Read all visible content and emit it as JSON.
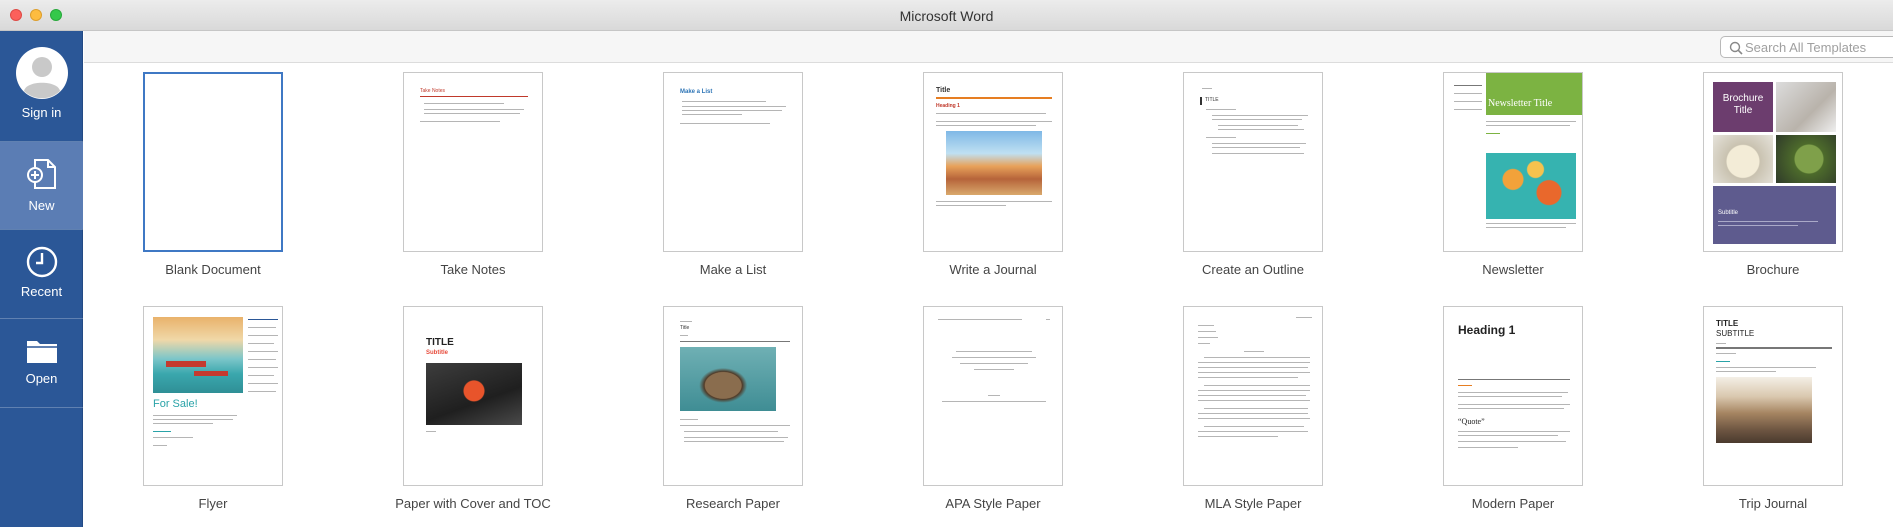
{
  "window": {
    "title": "Microsoft Word"
  },
  "sidebar": {
    "items": [
      {
        "label": "Sign in",
        "icon": "avatar-icon"
      },
      {
        "label": "New",
        "icon": "new-document-icon",
        "active": true
      },
      {
        "label": "Recent",
        "icon": "clock-icon"
      },
      {
        "label": "Open",
        "icon": "folder-icon"
      }
    ]
  },
  "search": {
    "placeholder": "Search All Templates"
  },
  "templates": [
    {
      "name": "Blank Document"
    },
    {
      "name": "Take Notes",
      "thumb_title": "Take Notes"
    },
    {
      "name": "Make a List",
      "thumb_title": "Make a List"
    },
    {
      "name": "Write a Journal",
      "thumb_title": "Title",
      "thumb_heading": "Heading 1"
    },
    {
      "name": "Create an Outline",
      "thumb_title": "TITLE"
    },
    {
      "name": "Newsletter",
      "thumb_title": "Newsletter Title"
    },
    {
      "name": "Brochure",
      "thumb_title": "Brochure Title",
      "thumb_subtitle": "Subtitle"
    },
    {
      "name": "Flyer",
      "thumb_title": "For Sale!"
    },
    {
      "name": "Paper with Cover and TOC",
      "thumb_title": "TITLE",
      "thumb_subtitle": "Subtitle"
    },
    {
      "name": "Research Paper",
      "thumb_title": "Title"
    },
    {
      "name": "APA Style Paper"
    },
    {
      "name": "MLA Style Paper"
    },
    {
      "name": "Modern Paper",
      "thumb_title": "Heading 1",
      "thumb_quote": "“Quote”"
    },
    {
      "name": "Trip Journal",
      "thumb_title": "TITLE",
      "thumb_subtitle": "SUBTITLE"
    }
  ],
  "colors": {
    "sidebar": "#2b5797",
    "sidebar_active": "#5b7db4",
    "selection": "#3f78c4",
    "newsletter_green": "#7cb342",
    "brochure_purple": "#6c3d6e",
    "brochure_slate": "#5e5b8e"
  }
}
